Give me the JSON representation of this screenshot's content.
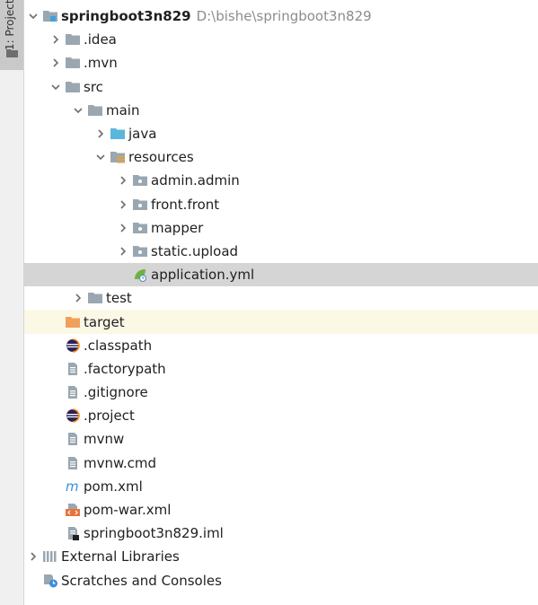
{
  "side_panel": {
    "label": "1: Project"
  },
  "tree": {
    "root": {
      "name": "springboot3n829",
      "path": "D:\\bishe\\springboot3n829"
    },
    "nodes": [
      {
        "label": ".idea"
      },
      {
        "label": ".mvn"
      },
      {
        "label": "src"
      },
      {
        "label": "main"
      },
      {
        "label": "java"
      },
      {
        "label": "resources"
      },
      {
        "label": "admin.admin"
      },
      {
        "label": "front.front"
      },
      {
        "label": "mapper"
      },
      {
        "label": "static.upload"
      },
      {
        "label": "application.yml"
      },
      {
        "label": "test"
      },
      {
        "label": "target"
      },
      {
        "label": ".classpath"
      },
      {
        "label": ".factorypath"
      },
      {
        "label": ".gitignore"
      },
      {
        "label": ".project"
      },
      {
        "label": "mvnw"
      },
      {
        "label": "mvnw.cmd"
      },
      {
        "label": "pom.xml"
      },
      {
        "label": "pom-war.xml"
      },
      {
        "label": "springboot3n829.iml"
      },
      {
        "label": "External Libraries"
      },
      {
        "label": "Scratches and Consoles"
      }
    ]
  },
  "colors": {
    "folder": "#9aa7b0",
    "source_folder": "#59b6dc",
    "excluded_folder": "#f1a05b",
    "selection": "#d5d5d5",
    "excluded_row": "#fcf8e6",
    "spring_green": "#6db33f"
  }
}
